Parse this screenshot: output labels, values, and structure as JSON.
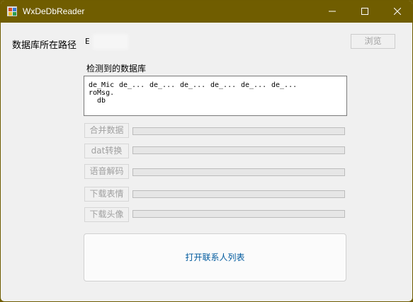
{
  "window": {
    "title": "WxDeDbReader"
  },
  "path_row": {
    "label": "数据库所在路径",
    "value": "E",
    "browse_label": "浏览"
  },
  "detected": {
    "label": "检测到的数据库",
    "items": [
      "de_Mic\nroMsg.\n  db",
      "de_...",
      "de_...",
      "de_...",
      "de_...",
      "de_...",
      "de_..."
    ]
  },
  "actions": [
    {
      "label": "合并数据",
      "progress": 0
    },
    {
      "label": "dat转换",
      "progress": 0
    },
    {
      "label": "语音解码",
      "progress": 0
    },
    {
      "label": "下载表情",
      "progress": 0
    },
    {
      "label": "下载头像",
      "progress": 0
    }
  ],
  "open_contacts_label": "打开联系人列表",
  "colors": {
    "titlebar": "#705d00",
    "window_bg": "#f0f0f0",
    "link_text": "#005a9e",
    "disabled_text": "#a0a0a0",
    "progress_fill": "#06b025"
  }
}
